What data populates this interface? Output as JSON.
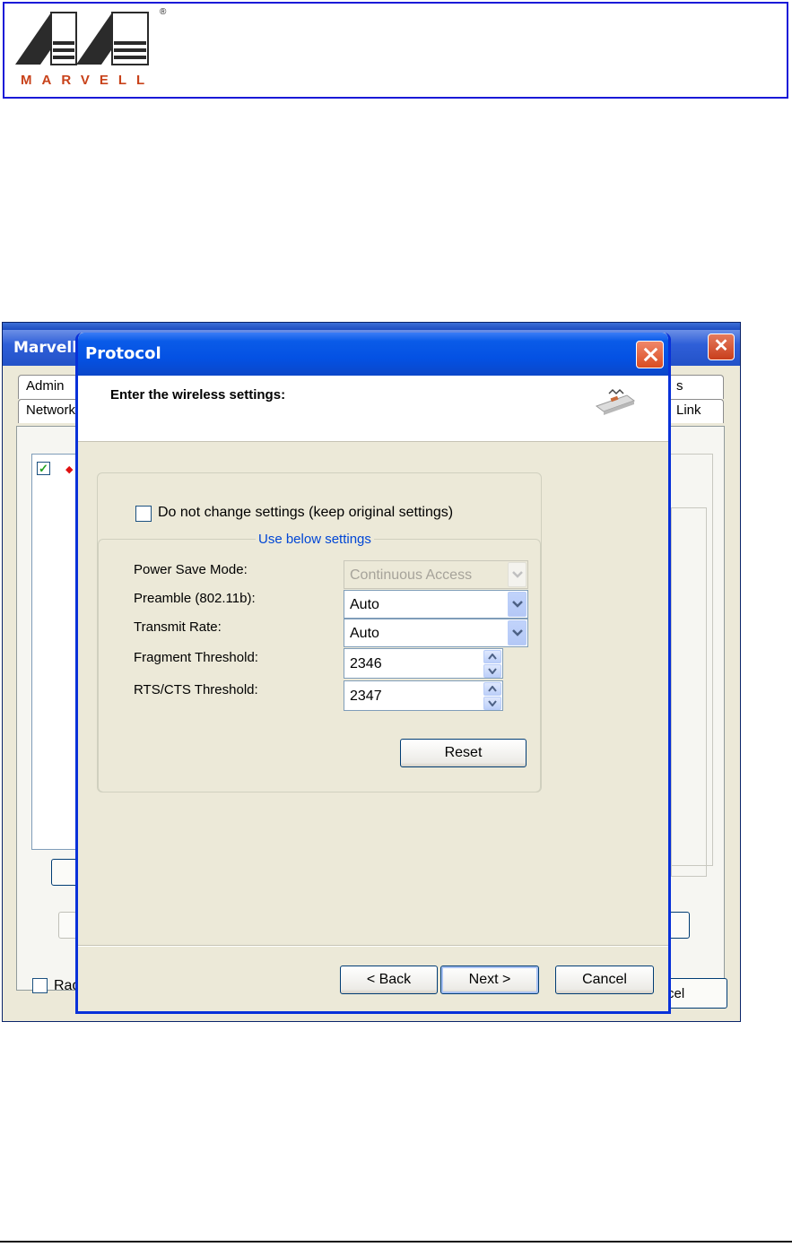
{
  "header": {
    "logo_text": "MARVELL",
    "registered_mark": "®"
  },
  "background_window": {
    "title": "Marvell",
    "tabs": [
      "Admin",
      "Network",
      "s",
      "Link"
    ],
    "bottom_checkbox_label": "Rad",
    "bottom_button_label": "cel"
  },
  "dialog": {
    "title": "Protocol",
    "heading": "Enter the wireless settings:",
    "keep_settings_label": "Do not change settings (keep original settings)",
    "keep_settings_checked": false,
    "group_title": "Use below settings",
    "fields": [
      {
        "label": "Power Save Mode:",
        "value": "Continuous Access",
        "type": "select",
        "disabled": true
      },
      {
        "label": "Preamble (802.11b):",
        "value": "Auto",
        "type": "select",
        "disabled": false
      },
      {
        "label": "Transmit Rate:",
        "value": "Auto",
        "type": "select",
        "disabled": false
      },
      {
        "label": "Fragment Threshold:",
        "value": "2346",
        "type": "spinner"
      },
      {
        "label": "RTS/CTS Threshold:",
        "value": "2347",
        "type": "spinner"
      }
    ],
    "reset_label": "Reset",
    "back_label": "< Back",
    "next_label": "Next >",
    "cancel_label": "Cancel"
  },
  "colors": {
    "banner_border": "#1a1ad8",
    "logo_orange": "#c8421a",
    "xp_title_blue": "#0451e3",
    "group_title_blue": "#0046d5"
  }
}
